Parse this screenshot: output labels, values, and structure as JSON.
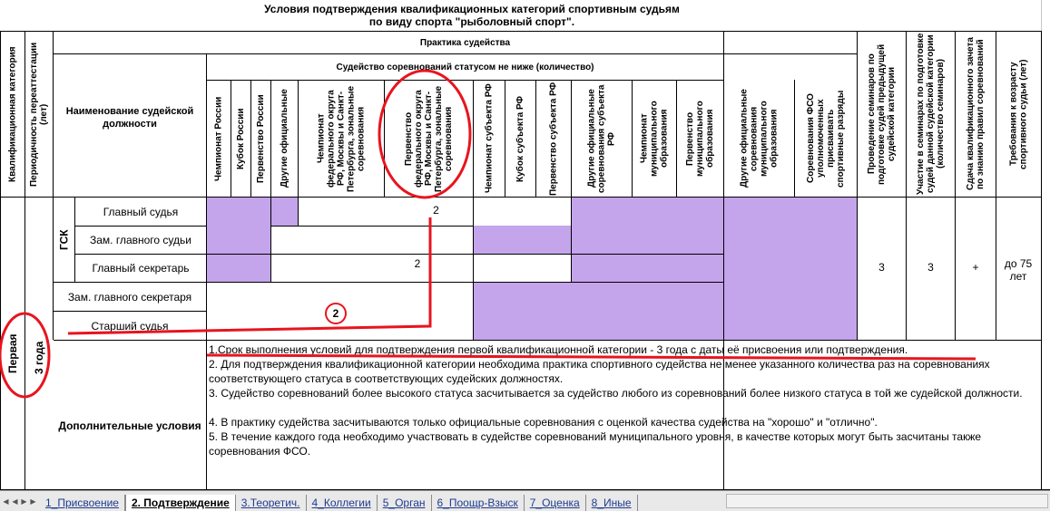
{
  "title": {
    "line1": "Условия  подтверждения квалификационных категорий спортивным судьям",
    "line2": "по виду спорта \"рыболовный спорт\"."
  },
  "headers": {
    "qualification_category": "Квалификационная категория",
    "recert_period": "Периодичность переаттестации (лет)",
    "position_name": "Наименование    судейской должности",
    "judging_practice": "Практика судейства",
    "status_not_lower": "Судейство соревнований статусом не ниже (количество)",
    "columns": [
      "Чемпионат России",
      "Кубок России",
      "Первенство России",
      "Другие официальные",
      "Чемпионат федерального округа РФ, Москвы и Санкт-Петербурга, зональные соревнования",
      "Первенство федерального округа РФ, Москвы и Санкт-Петербурга, зональные соревнования",
      "Чемпионат субъекта РФ",
      "Кубок субъекта РФ",
      "Первенство субъекта РФ",
      "Другие официальные соревнования субъекта РФ",
      "Чемпионат муниципального образования",
      "Первенство муниципального образования",
      "Другие официальные соревнования муниципального образования",
      "Соревнования ФСО уполномоченных присваивать спортивные разряды"
    ],
    "seminars_conduct": "Проведение семинаров по подготовке судей предыдущей судейской категории",
    "seminars_participation": "Участие в   семинарах по подготовке судей данной судейской категории (количество семинаров)",
    "qualification_exam": "Сдача квалификационного зачета по знанию правил соревнований",
    "age_requirement": "Требования к возрасту спортивного судьи (лет)"
  },
  "rows": {
    "gsk": "ГСК",
    "chief_judge": "Главный судья",
    "deputy_chief_judge": "Зам. главного судьи",
    "chief_secretary": "Главный секретарь",
    "deputy_chief_secretary": "Зам. главного секретаря",
    "senior_judge": "Старший судья",
    "value_2a": "2",
    "value_2b": "2",
    "seminars_conduct_value": "3",
    "seminars_participation_value": "3",
    "exam_value": "+",
    "age_value": "до 75 лет"
  },
  "category": {
    "name": "Первая",
    "period": "3 года"
  },
  "additional": {
    "label": "Дополнительные условия",
    "items": [
      "1.Срок выполнения условий для подтверждения первой квалификационной  категории - 3 года  с даты её присвоения или подтверждения.",
      "2. Для подтверждения квалификационной категории необходима практика спортивного судейства не менее указанного количества раз на соревнованиях соответствующего статуса в соответствующих судейских должностях.",
      "3. Судейство соревнований более высокого статуса засчитывается за судейство любого из соревнований более низкого статуса в той же судейской должности.",
      "4. В практику судейства засчитываются только официальные соревнования с оценкой качества судейства на \"хорошо\" и \"отлично\".",
      "5. В течение каждого года необходимо участвовать в судействе соревнований муниципального уровня, в качестве которых могут быть засчитаны также соревнования ФСО."
    ]
  },
  "annotation": {
    "marker": "2"
  },
  "tabs": [
    {
      "label": "1_Присвоение",
      "active": false
    },
    {
      "label": "2. Подтверждение",
      "active": true
    },
    {
      "label": "3.Теоретич.",
      "active": false
    },
    {
      "label": "4_Коллегии",
      "active": false
    },
    {
      "label": "5_Орган",
      "active": false
    },
    {
      "label": "6_Поощр-Взыск",
      "active": false
    },
    {
      "label": "7_Оценка",
      "active": false
    },
    {
      "label": "8_Иные",
      "active": false
    }
  ],
  "colors": {
    "highlight": "#c4a4ea",
    "annotation_red": "#e8141e",
    "tab_text": "#1f3b8f"
  }
}
